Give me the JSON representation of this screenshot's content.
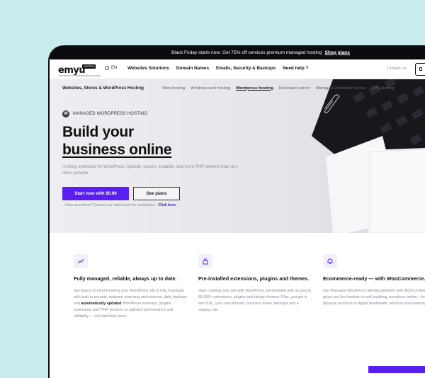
{
  "promo": {
    "text": "Black Friday starts now: Get 75% off services premium managed hosting",
    "link": "Shop plans"
  },
  "nav": {
    "logo": "emyu",
    "logo_badge": "HOSTING",
    "logo_tagline": "YOUR DIGITAL FOUNDATION WITH NO CHARGE",
    "lang": "EN",
    "menu": [
      "Websites Solutions",
      "Domain Names",
      "Emails, Security & Backups",
      "Need help ?"
    ],
    "contact": "Contact Us"
  },
  "subnav": {
    "heading": "Websites, Stores & WordPress Hosting",
    "items": [
      "Web hosting",
      "Windows web hosting",
      "Wordpress hosting",
      "Dedicated server",
      "Managed Dedicated Server",
      "VPS hosting"
    ]
  },
  "hero": {
    "eyebrow": "MANAGED WORDPRESS HOSTING",
    "title_line1": "Build your",
    "title_line2": "business online",
    "description": "Hosting optimized for WordPress. Speedy, secure, scalable, and more PHP workers than any other provider.",
    "cta": "Start now with $0.99",
    "secondary": "See plans",
    "help_text": "Have questions? Contact our sales team for assistance.",
    "help_link": "Click here"
  },
  "features": [
    {
      "icon": "chart-icon",
      "title": "Fully managed, reliable, always up to date.",
      "body_pre": "Get peace of mind knowing your WordPress site is fully managed with built-in security, malware scanning and removal, daily backups and ",
      "body_bold": "automatically updated",
      "body_post": " WordPress software, plugins, extensions and PHP versions to optimize performance and reliability — and fast load times."
    },
    {
      "icon": "plugin-icon",
      "title": "Pre-installed extensions, plugins and themes.",
      "body_pre": "Start creating your site with WordPress pre-installed with access to 55,000+ extensions, plugins and design themes. Plus, you get a free SSL, your own domain, business email, backups and a staging site.",
      "body_bold": "",
      "body_post": ""
    },
    {
      "icon": "bell-icon",
      "title": "Ecommerce-ready — with WooCommerce.",
      "body_pre": "Our Managed WordPress Hosting platform with WooCommerce gives you the freedom to sell anything, anywhere online – from physical products to digital downloads, services and subscriptions.",
      "body_bold": "",
      "body_post": ""
    }
  ],
  "colors": {
    "accent": "#5a1ef2",
    "promo_bg": "#0a0a0f",
    "page_bg": "#c8ecec"
  }
}
